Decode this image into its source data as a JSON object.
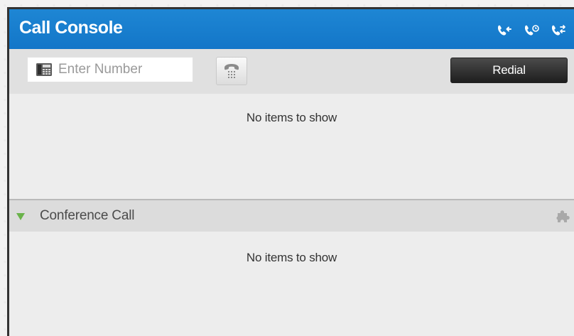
{
  "window": {
    "title": "Call Console"
  },
  "header_icons": [
    "incoming-call-icon",
    "call-history-icon",
    "transfer-call-icon"
  ],
  "toolbar": {
    "number_placeholder": "Enter Number",
    "number_value": "",
    "redial_label": "Redial"
  },
  "calls": {
    "empty_text": "No items to show"
  },
  "conference": {
    "title": "Conference Call",
    "empty_text": "No items to show",
    "expanded": true
  },
  "colors": {
    "titlebar": "#1a7fcf",
    "accent_green": "#6ab34a",
    "redial_bg": "#2f2f2f"
  }
}
